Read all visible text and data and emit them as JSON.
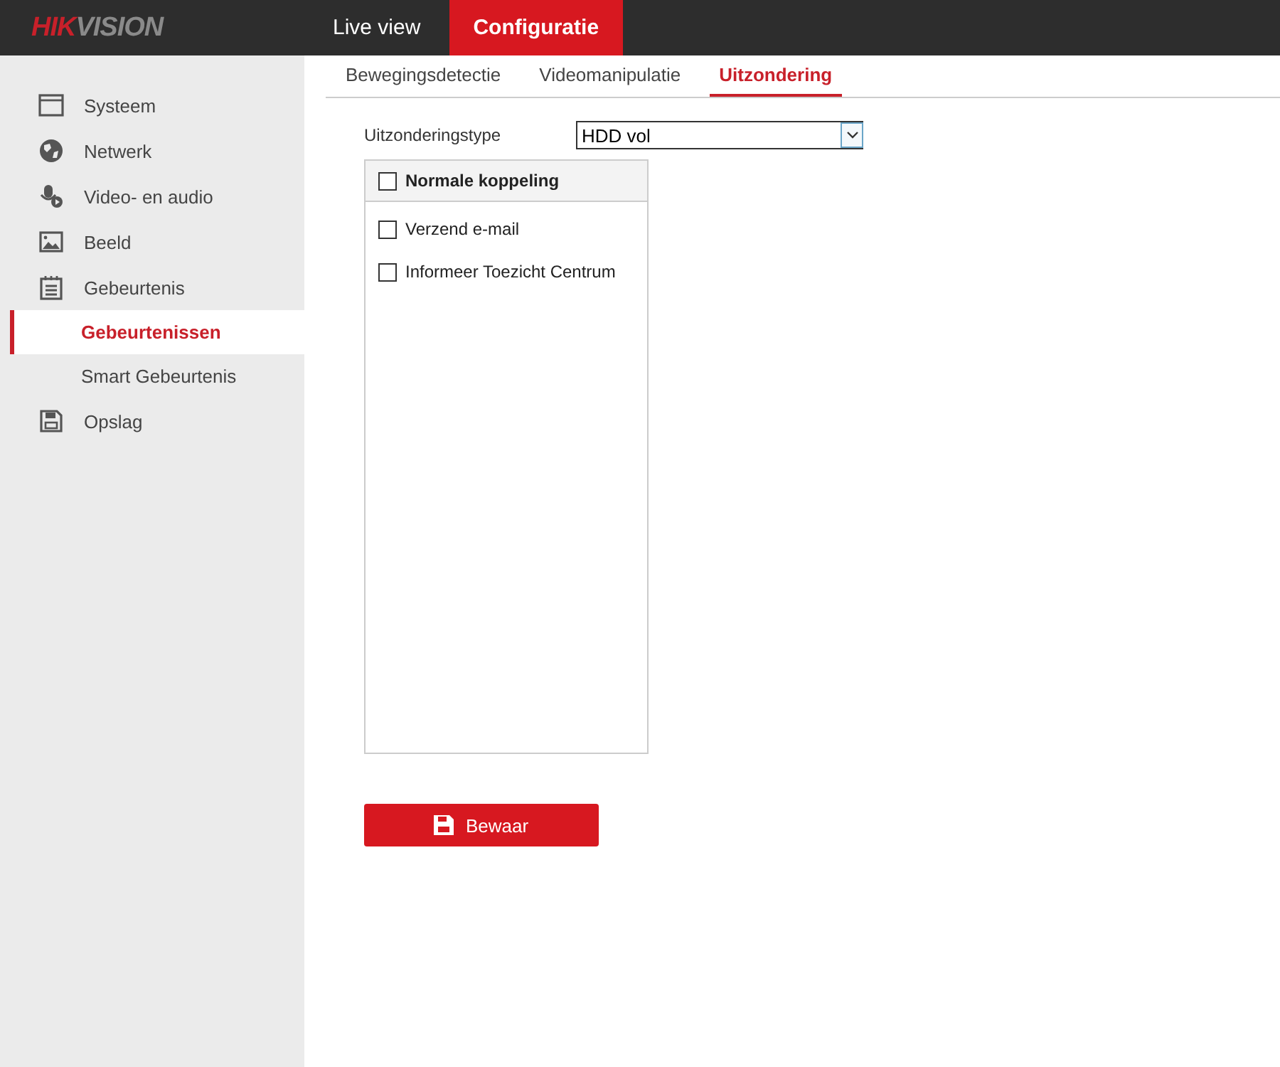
{
  "header": {
    "logo": {
      "accent": "HIK",
      "rest": "VISION"
    },
    "nav": [
      {
        "label": "Live view",
        "selected": false
      },
      {
        "label": "Configuratie",
        "selected": true
      }
    ]
  },
  "sidebar": {
    "items": [
      {
        "label": "Systeem",
        "kind": "main",
        "selected": false
      },
      {
        "label": "Netwerk",
        "kind": "main",
        "selected": false
      },
      {
        "label": "Video- en audio",
        "kind": "main",
        "selected": false
      },
      {
        "label": "Beeld",
        "kind": "main",
        "selected": false
      },
      {
        "label": "Gebeurtenis",
        "kind": "main",
        "selected": false
      },
      {
        "label": "Gebeurtenissen",
        "kind": "sub",
        "selected": true
      },
      {
        "label": "Smart Gebeurtenis",
        "kind": "sub",
        "selected": false
      },
      {
        "label": "Opslag",
        "kind": "main",
        "selected": false
      }
    ]
  },
  "tabs": [
    {
      "label": "Bewegingsdetectie",
      "selected": false
    },
    {
      "label": "Videomanipulatie",
      "selected": false
    },
    {
      "label": "Uitzondering",
      "selected": true
    }
  ],
  "exception_type": {
    "label": "Uitzonderingstype",
    "value": "HDD vol"
  },
  "linkage": {
    "header": {
      "label": "Normale koppeling",
      "checked": false
    },
    "options": [
      {
        "label": "Verzend e-mail",
        "checked": false
      },
      {
        "label": "Informeer Toezicht Centrum",
        "checked": false
      }
    ]
  },
  "save_button": "Bewaar"
}
